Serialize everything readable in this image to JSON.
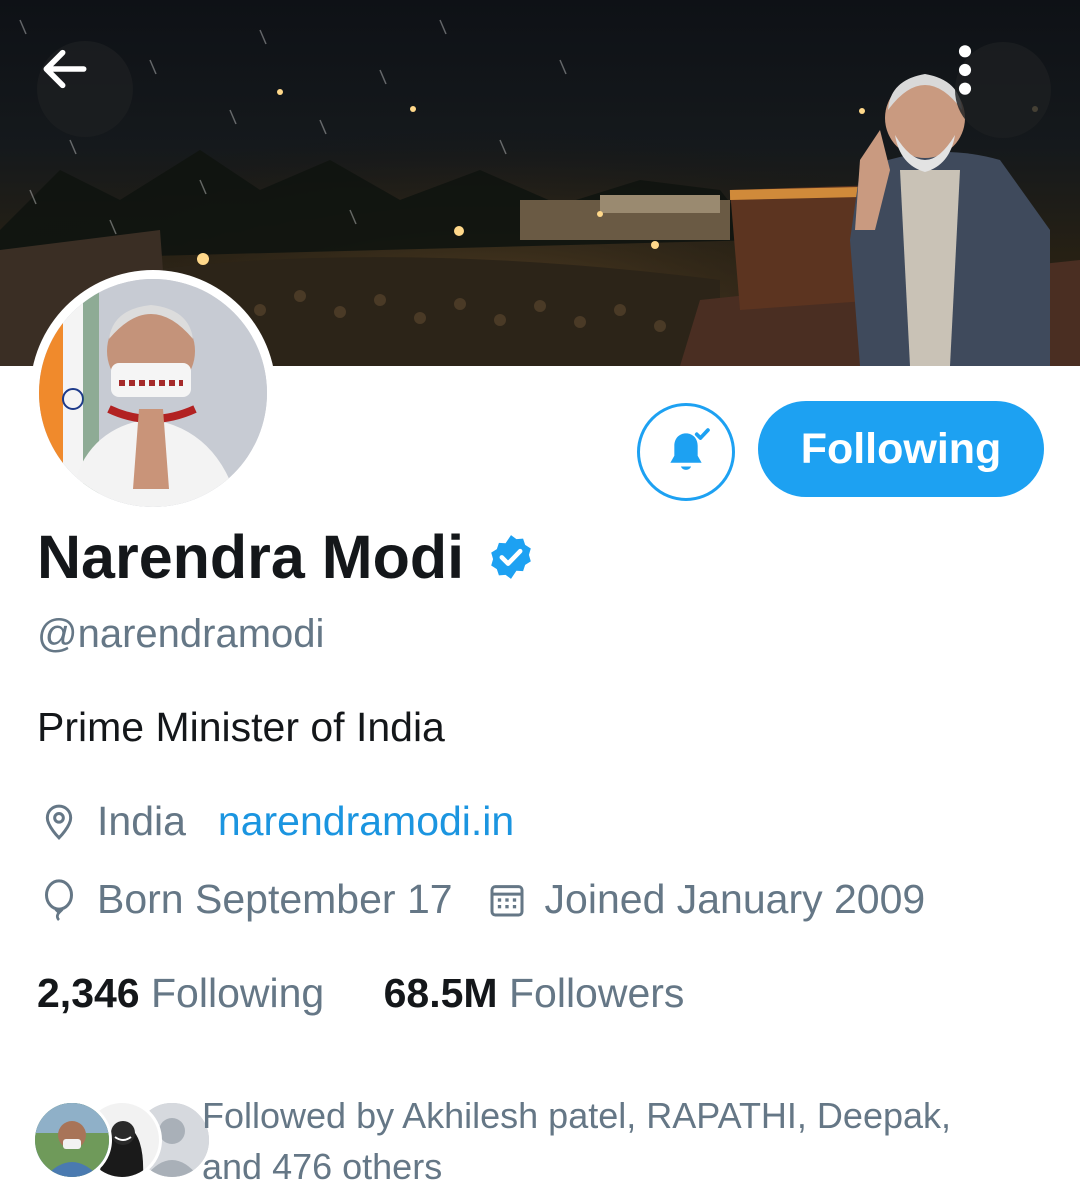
{
  "header": {
    "back_icon": "arrow-left-icon",
    "more_icon": "more-vertical-icon"
  },
  "profile": {
    "name": "Narendra Modi",
    "verified_icon": "verified-badge-icon",
    "handle": "@narendramodi",
    "bio": "Prime Minister of India",
    "location": "India",
    "website": "narendramodi.in",
    "birthday": "Born September 17",
    "joined": "Joined January 2009"
  },
  "actions": {
    "notify_icon": "bell-check-icon",
    "follow_label": "Following"
  },
  "stats": {
    "following_count": "2,346",
    "following_label": "Following",
    "followers_count": "68.5M",
    "followers_label": "Followers"
  },
  "followed_by": {
    "text_line1": "Followed by Akhilesh patel, RAPATHI, Deepak,",
    "text_line2": "and 476 others"
  },
  "colors": {
    "accent": "#1da1f2",
    "link": "#1b95e0",
    "text_primary": "#14171a",
    "text_secondary": "#657786"
  }
}
